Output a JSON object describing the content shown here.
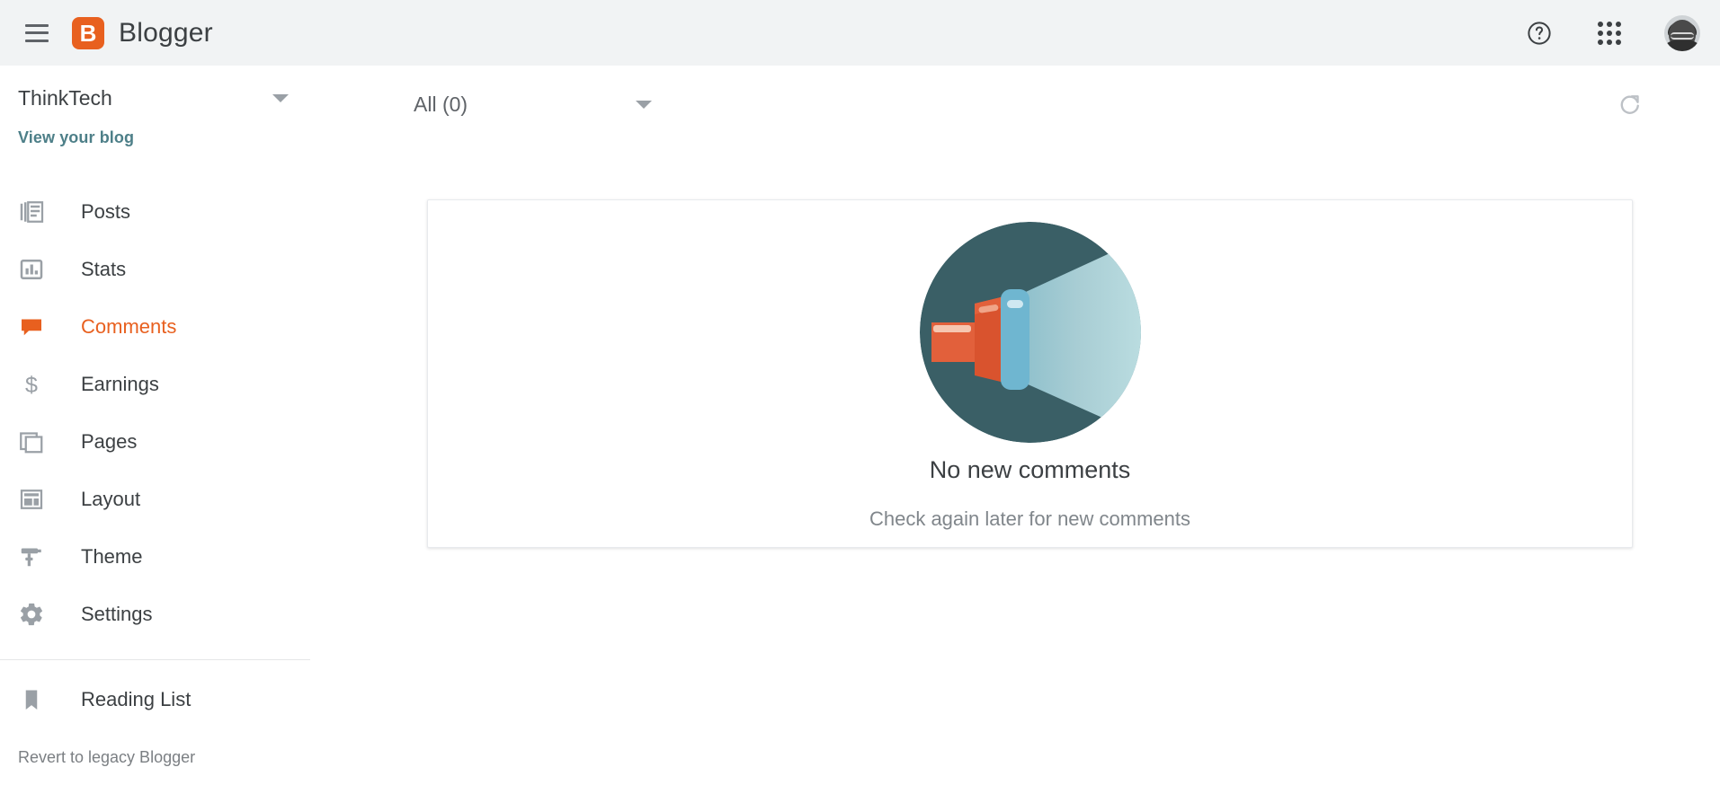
{
  "appbar": {
    "menu_icon": "hamburger-icon",
    "logo_letter": "B",
    "brand": "Blogger",
    "help_icon": "help-circle-icon",
    "apps_icon": "apps-grid-icon",
    "avatar_icon": "user-avatar"
  },
  "sidebar": {
    "blog_name": "ThinkTech",
    "blog_caret_icon": "chevron-down-icon",
    "view_blog": "View your blog",
    "items": [
      {
        "label": "Posts",
        "icon": "posts-icon",
        "active": false
      },
      {
        "label": "Stats",
        "icon": "stats-icon",
        "active": false
      },
      {
        "label": "Comments",
        "icon": "comments-icon",
        "active": true
      },
      {
        "label": "Earnings",
        "icon": "earnings-icon",
        "active": false
      },
      {
        "label": "Pages",
        "icon": "pages-icon",
        "active": false
      },
      {
        "label": "Layout",
        "icon": "layout-icon",
        "active": false
      },
      {
        "label": "Theme",
        "icon": "theme-icon",
        "active": false
      },
      {
        "label": "Settings",
        "icon": "settings-icon",
        "active": false
      }
    ],
    "secondary": [
      {
        "label": "Reading List",
        "icon": "bookmark-icon"
      }
    ],
    "revert": "Revert to legacy Blogger"
  },
  "toolbar": {
    "filter_value": "All (0)",
    "filter_caret_icon": "chevron-down-icon",
    "refresh_icon": "refresh-icon"
  },
  "empty_state": {
    "illustration": "flashlight-illustration",
    "title": "No new comments",
    "subtitle": "Check again later for new comments"
  },
  "colors": {
    "brand_orange": "#e8601f",
    "appbar_bg": "#f1f3f4",
    "text_primary": "#3c4043",
    "text_secondary": "#80868b",
    "link_teal": "#4d7f88",
    "illus_circle": "#3a5f66",
    "illus_body": "#e0603a",
    "illus_lens": "#6fb6d0",
    "illus_beam": "#a9ccd4"
  }
}
